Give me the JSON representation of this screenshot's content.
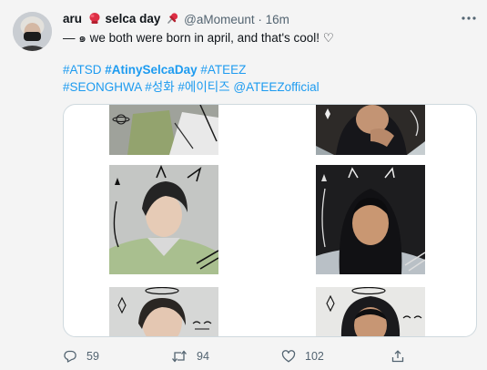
{
  "user": {
    "display_name": "aru",
    "display_name_suffix": "selca day",
    "handle": "@aMomeunt",
    "separator": "·",
    "time": "16m"
  },
  "tweet": {
    "text": "— ๑ we both were born in april, and that's cool! ♡",
    "hashtags_line1": [
      "#ATSD",
      "#AtinySelcaDay",
      "#ATEEZ"
    ],
    "hashtags_line2": [
      "#SEONGHWA",
      "#성화",
      "#에이티즈",
      "@ATEEZofficial"
    ]
  },
  "actions": {
    "reply_count": "59",
    "retweet_count": "94",
    "like_count": "102"
  },
  "icons": {
    "more": "more-horizontal-icon",
    "reply": "reply-icon",
    "retweet": "retweet-icon",
    "like": "heart-icon",
    "share": "share-icon",
    "emoji_1": "boxing-glove-icon",
    "emoji_2": "pushpin-icon"
  },
  "colors": {
    "link": "#1d9bf0",
    "secondary_text": "#536471",
    "background": "#f4f4f4"
  }
}
